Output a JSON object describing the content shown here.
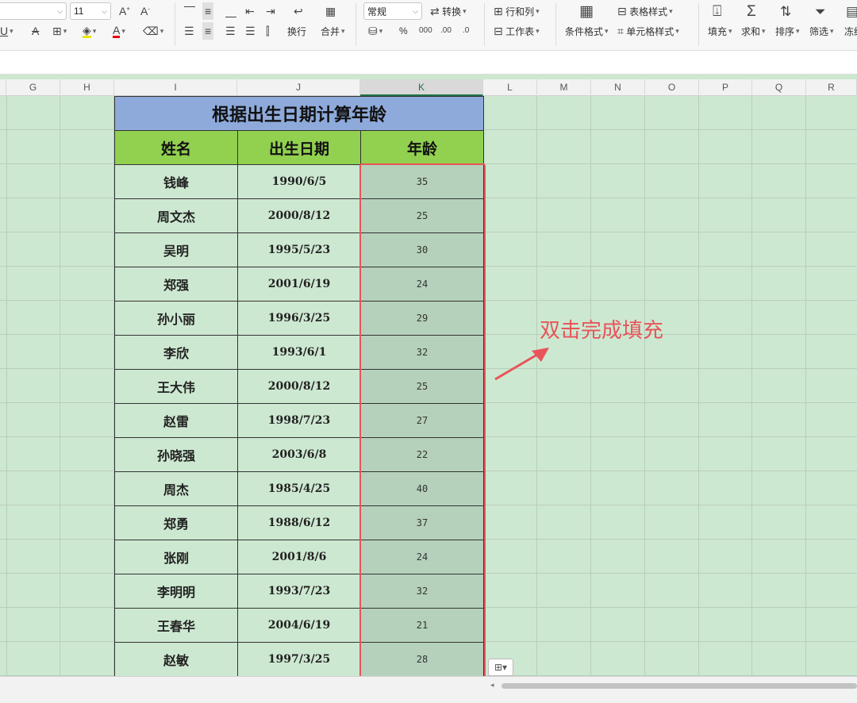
{
  "ribbon": {
    "font_size": "11",
    "number_format": "常规",
    "convert_label": "转换",
    "row_col_label": "行和列",
    "worksheet_label": "工作表",
    "wrap_label": "换行",
    "merge_label": "合并",
    "percent": "%",
    "conditional_format_label": "条件格式",
    "table_style_label": "表格样式",
    "cell_style_label": "单元格样式",
    "fill_label": "填充",
    "sum_label": "求和",
    "sort_label": "排序",
    "filter_label": "筛选",
    "freeze_label": "冻结"
  },
  "columns": [
    "G",
    "H",
    "I",
    "J",
    "K",
    "L",
    "M",
    "N",
    "O",
    "P",
    "Q",
    "R"
  ],
  "table": {
    "title": "根据出生日期计算年龄",
    "headers": [
      "姓名",
      "出生日期",
      "年龄"
    ],
    "rows": [
      {
        "name": "钱峰",
        "date": "1990/6/5",
        "age": "35"
      },
      {
        "name": "周文杰",
        "date": "2000/8/12",
        "age": "25"
      },
      {
        "name": "吴明",
        "date": "1995/5/23",
        "age": "30"
      },
      {
        "name": "郑强",
        "date": "2001/6/19",
        "age": "24"
      },
      {
        "name": "孙小丽",
        "date": "1996/3/25",
        "age": "29"
      },
      {
        "name": "李欣",
        "date": "1993/6/1",
        "age": "32"
      },
      {
        "name": "王大伟",
        "date": "2000/8/12",
        "age": "25"
      },
      {
        "name": "赵雷",
        "date": "1998/7/23",
        "age": "27"
      },
      {
        "name": "孙晓强",
        "date": "2003/6/8",
        "age": "22"
      },
      {
        "name": "周杰",
        "date": "1985/4/25",
        "age": "40"
      },
      {
        "name": "郑勇",
        "date": "1988/6/12",
        "age": "37"
      },
      {
        "name": "张刚",
        "date": "2001/8/6",
        "age": "24"
      },
      {
        "name": "李明明",
        "date": "1993/7/23",
        "age": "32"
      },
      {
        "name": "王春华",
        "date": "2004/6/19",
        "age": "21"
      },
      {
        "name": "赵敏",
        "date": "1997/3/25",
        "age": "28"
      }
    ]
  },
  "annotation": "双击完成填充",
  "colors": {
    "accent": "#e8545a",
    "title_bg": "#8eaadb",
    "header_bg": "#92d050",
    "sheet_bg": "#cde8d1"
  }
}
